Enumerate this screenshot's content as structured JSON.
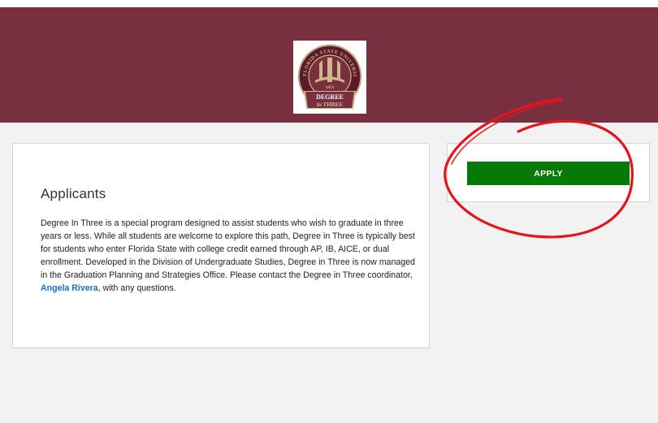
{
  "header": {
    "logo": {
      "icon": "fsu-degree-in-three-seal",
      "seal_text": "FLORIDA STATE UNIVERSITY",
      "year": "1851",
      "banner_line1": "DEGREE",
      "banner_line2": "in THREE"
    },
    "colors": {
      "garnet": "#782f40",
      "gold": "#ceb888"
    }
  },
  "main": {
    "title": "Applicants",
    "body_text": "Degree In Three is a special program designed to assist students who wish to graduate in three years or less. While all students are welcome to explore this path, Degree in Three is typically best for students who enter Florida State with college credit earned through AP, IB, AICE, or dual enrollment. Developed in the Division of Undergraduate Studies, Degree in Three is now managed in the Graduation Planning and Strategies Office. Please contact the Degree in Three coordinator, ",
    "contact_link": "Angela Rivera",
    "body_suffix": ", with any questions."
  },
  "sidebar": {
    "apply_label": "APPLY",
    "apply_color": "#067a06",
    "annotation": {
      "shape": "hand-drawn-circle",
      "color": "#e3141e"
    }
  }
}
